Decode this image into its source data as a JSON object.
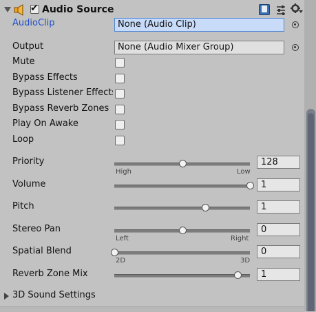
{
  "component": {
    "title": "Audio Source",
    "enabled": true,
    "icon": "speaker-icon"
  },
  "fields": {
    "audio_clip": {
      "label": "AudioClip",
      "value": "None (Audio Clip)"
    },
    "output": {
      "label": "Output",
      "value": "None (Audio Mixer Group)"
    }
  },
  "toggles": [
    {
      "label": "Mute",
      "checked": false
    },
    {
      "label": "Bypass Effects",
      "checked": false
    },
    {
      "label": "Bypass Listener Effects",
      "checked": false
    },
    {
      "label": "Bypass Reverb Zones",
      "checked": false
    },
    {
      "label": "Play On Awake",
      "checked": false
    },
    {
      "label": "Loop",
      "checked": false
    }
  ],
  "sliders": [
    {
      "label": "Priority",
      "value": "128",
      "min": 0,
      "max": 256,
      "fraction": 0.5,
      "left_tick": "High",
      "right_tick": "Low"
    },
    {
      "label": "Volume",
      "value": "1",
      "min": 0,
      "max": 1,
      "fraction": 1.0
    },
    {
      "label": "Pitch",
      "value": "1",
      "min": -3,
      "max": 3,
      "fraction": 0.67
    },
    {
      "label": "Stereo Pan",
      "value": "0",
      "min": -1,
      "max": 1,
      "fraction": 0.5,
      "left_tick": "Left",
      "right_tick": "Right"
    },
    {
      "label": "Spatial Blend",
      "value": "0",
      "min": 0,
      "max": 1,
      "fraction": 0.0,
      "left_tick": "2D",
      "right_tick": "3D"
    },
    {
      "label": "Reverb Zone Mix",
      "value": "1",
      "min": 0,
      "max": 1.1,
      "fraction": 0.91
    }
  ],
  "subsection": {
    "label": "3D Sound Settings",
    "expanded": false
  },
  "colors": {
    "panel_bg": "#c2c2c2",
    "selected_field": "#c8dcf9",
    "link_label": "#1f4fc9"
  }
}
